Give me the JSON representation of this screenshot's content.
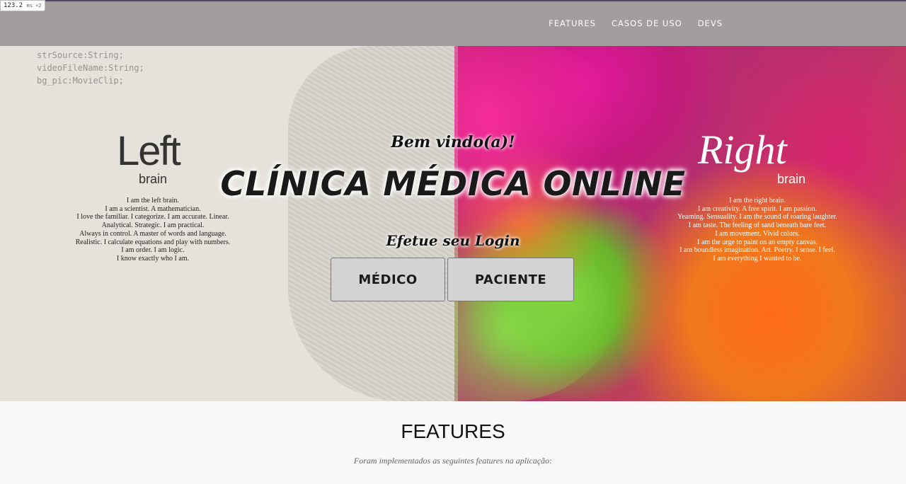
{
  "perf": {
    "value": "123.2",
    "unit": "ms ×2"
  },
  "nav": {
    "items": [
      "FEATURES",
      "CASOS DE USO",
      "DEVS"
    ]
  },
  "hero": {
    "code_lines": [
      "strSource:String;",
      "videoFileName:String;",
      "bg_pic:MovieClip;"
    ],
    "left": {
      "title": "Left",
      "sub": "brain",
      "lines": [
        "I am the left brain.",
        "I am a scientist. A mathematician.",
        "I love the familiar. I categorize. I am accurate. Linear.",
        "Analytical. Strategic. I am practical.",
        "Always in control. A master of words and language.",
        "Realistic. I calculate equations and play with numbers.",
        "I am order. I am logic.",
        "I know exactly who I am."
      ]
    },
    "right": {
      "title": "Right",
      "sub": "brain",
      "lines": [
        "I am the right brain.",
        "I am creativity. A free spirit. I am passion.",
        "Yearning. Sensuality. I am the sound of roaring laughter.",
        "I am taste. The feeling of sand beneath bare feet.",
        "I am movement. Vivid colors.",
        "I am the urge to paint on an empty canvas.",
        "I am boundless imagination. Art. Poetry. I sense. I feel.",
        "I am everything I wanted to be."
      ]
    },
    "welcome": "Bem vindo(a)!",
    "title": "CLÍNICA MÉDICA ONLINE",
    "login_label": "Efetue seu Login",
    "buttons": {
      "medico": "MÉDICO",
      "paciente": "PACIENTE"
    }
  },
  "features": {
    "heading": "FEATURES",
    "subtitle": "Foram implementados as seguintes features na aplicação:"
  }
}
